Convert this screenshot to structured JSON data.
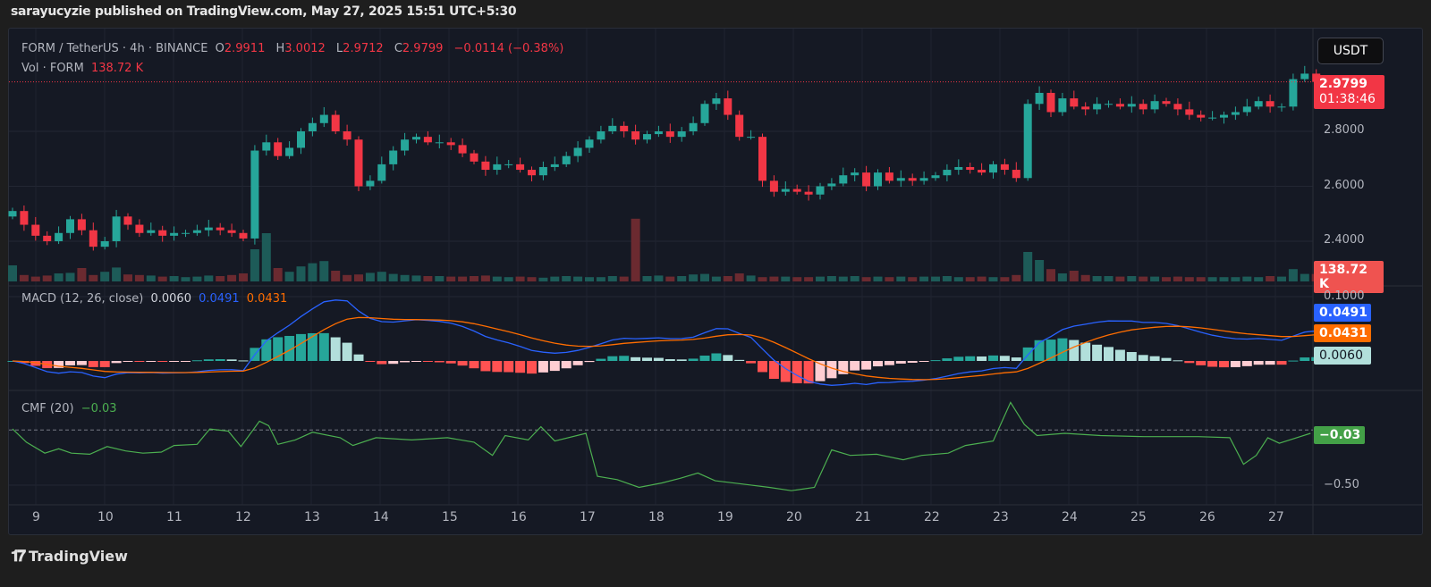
{
  "header": {
    "published": "sarayucyzie published on TradingView.com, May 27, 2025 15:51 UTC+5:30"
  },
  "legend": {
    "symbol": "FORM / TetherUS · 4h · BINANCE",
    "o_label": "O",
    "o": "2.9911",
    "h_label": "H",
    "h": "3.0012",
    "l_label": "L",
    "l": "2.9712",
    "c_label": "C",
    "c": "2.9799",
    "change": "−0.0114 (−0.38%)",
    "vol_label": "Vol · FORM",
    "vol": "138.72 K"
  },
  "currency_button": "USDT",
  "price_badge": {
    "price": "2.9799",
    "countdown": "01:38:46"
  },
  "volume_badge": "138.72 K",
  "macd": {
    "label": "MACD (12, 26, close)",
    "hist": "0.0060",
    "macd": "0.0491",
    "signal": "0.0431",
    "axis_tick": "0.1000"
  },
  "cmf": {
    "label": "CMF (20)",
    "value": "−0.03",
    "axis_tick": "−0.50"
  },
  "footer": {
    "brand": "TradingView"
  },
  "colors": {
    "up": "#26a69a",
    "down": "#f23645",
    "macd": "#2962ff",
    "signal": "#ff6d00",
    "cmf": "#4caf50"
  },
  "chart_data": {
    "type": "candlestick",
    "interval": "4h",
    "price_ticks": [
      "2.8000",
      "2.6000",
      "2.4000"
    ],
    "price_tick_values": [
      2.8,
      2.6,
      2.4
    ],
    "ylim": [
      2.32,
      3.05
    ],
    "x_tick_labels": [
      "9",
      "10",
      "11",
      "12",
      "13",
      "14",
      "15",
      "16",
      "17",
      "18",
      "19",
      "20",
      "21",
      "22",
      "23",
      "24",
      "25",
      "26",
      "27"
    ],
    "first_open": 2.49,
    "closes": [
      2.51,
      2.46,
      2.42,
      2.4,
      2.43,
      2.48,
      2.44,
      2.38,
      2.4,
      2.49,
      2.46,
      2.43,
      2.44,
      2.42,
      2.43,
      2.43,
      2.44,
      2.45,
      2.44,
      2.43,
      2.41,
      2.73,
      2.76,
      2.71,
      2.74,
      2.8,
      2.83,
      2.86,
      2.8,
      2.77,
      2.6,
      2.62,
      2.68,
      2.73,
      2.77,
      2.78,
      2.76,
      2.76,
      2.75,
      2.72,
      2.69,
      2.66,
      2.68,
      2.68,
      2.66,
      2.64,
      2.67,
      2.68,
      2.71,
      2.74,
      2.77,
      2.8,
      2.82,
      2.8,
      2.77,
      2.79,
      2.8,
      2.78,
      2.8,
      2.83,
      2.9,
      2.92,
      2.86,
      2.78,
      2.78,
      2.62,
      2.58,
      2.59,
      2.58,
      2.57,
      2.6,
      2.61,
      2.64,
      2.65,
      2.6,
      2.65,
      2.62,
      2.63,
      2.62,
      2.63,
      2.64,
      2.66,
      2.67,
      2.66,
      2.65,
      2.68,
      2.66,
      2.63,
      2.9,
      2.94,
      2.87,
      2.92,
      2.89,
      2.88,
      2.9,
      2.9,
      2.89,
      2.9,
      2.88,
      2.91,
      2.9,
      2.88,
      2.86,
      2.85,
      2.85,
      2.86,
      2.87,
      2.89,
      2.91,
      2.89,
      2.89,
      2.99,
      3.01,
      2.98
    ],
    "volumes_k": [
      300,
      120,
      90,
      110,
      150,
      160,
      250,
      120,
      180,
      260,
      130,
      120,
      110,
      90,
      100,
      80,
      90,
      110,
      100,
      120,
      150,
      600,
      900,
      250,
      180,
      280,
      340,
      380,
      200,
      120,
      130,
      160,
      180,
      140,
      120,
      110,
      100,
      100,
      90,
      90,
      100,
      110,
      90,
      80,
      90,
      80,
      70,
      90,
      100,
      90,
      80,
      80,
      100,
      90,
      1170,
      100,
      110,
      90,
      100,
      130,
      140,
      90,
      100,
      150,
      110,
      80,
      90,
      90,
      80,
      80,
      90,
      100,
      90,
      100,
      80,
      90,
      80,
      90,
      80,
      90,
      90,
      100,
      80,
      80,
      90,
      80,
      80,
      120,
      550,
      400,
      230,
      150,
      200,
      120,
      100,
      100,
      90,
      100,
      90,
      90,
      80,
      90,
      80,
      80,
      80,
      80,
      80,
      90,
      80,
      100,
      90,
      230,
      140,
      138.72
    ],
    "cmf_points": [
      [
        0,
        0.01
      ],
      [
        1.2,
        -0.11
      ],
      [
        2.8,
        -0.21
      ],
      [
        4,
        -0.17
      ],
      [
        5.1,
        -0.21
      ],
      [
        6.7,
        -0.22
      ],
      [
        8.2,
        -0.15
      ],
      [
        9.8,
        -0.19
      ],
      [
        11.3,
        -0.21
      ],
      [
        12.9,
        -0.2
      ],
      [
        14,
        -0.14
      ],
      [
        16,
        -0.13
      ],
      [
        17.1,
        0.01
      ],
      [
        18.7,
        -0.01
      ],
      [
        19.8,
        -0.15
      ],
      [
        21.4,
        0.08
      ],
      [
        22.2,
        0.04
      ],
      [
        23,
        -0.13
      ],
      [
        24.5,
        -0.09
      ],
      [
        26,
        -0.02
      ],
      [
        28.4,
        -0.07
      ],
      [
        29.5,
        -0.14
      ],
      [
        31.5,
        -0.07
      ],
      [
        34.6,
        -0.09
      ],
      [
        37.7,
        -0.07
      ],
      [
        40,
        -0.11
      ],
      [
        41.6,
        -0.23
      ],
      [
        42.7,
        -0.05
      ],
      [
        44.7,
        -0.09
      ],
      [
        45.8,
        0.03
      ],
      [
        47,
        -0.1
      ],
      [
        49.7,
        -0.03
      ],
      [
        50.7,
        -0.42
      ],
      [
        52.4,
        -0.45
      ],
      [
        54.3,
        -0.52
      ],
      [
        56.3,
        -0.48
      ],
      [
        57.8,
        -0.44
      ],
      [
        59.4,
        -0.39
      ],
      [
        60.9,
        -0.46
      ],
      [
        63.3,
        -0.49
      ],
      [
        65.6,
        -0.52
      ],
      [
        67.5,
        -0.55
      ],
      [
        69.5,
        -0.52
      ],
      [
        71,
        -0.18
      ],
      [
        72.6,
        -0.23
      ],
      [
        74.9,
        -0.22
      ],
      [
        77.2,
        -0.27
      ],
      [
        78.8,
        -0.23
      ],
      [
        81.1,
        -0.21
      ],
      [
        82.6,
        -0.14
      ],
      [
        85,
        -0.1
      ],
      [
        86.5,
        0.25
      ],
      [
        87.7,
        0.05
      ],
      [
        88.8,
        -0.05
      ],
      [
        91.2,
        -0.03
      ],
      [
        94.3,
        -0.05
      ],
      [
        98.1,
        -0.06
      ],
      [
        102.8,
        -0.06
      ],
      [
        105.5,
        -0.07
      ],
      [
        106.7,
        -0.31
      ],
      [
        107.8,
        -0.23
      ],
      [
        108.8,
        -0.07
      ],
      [
        109.8,
        -0.12
      ],
      [
        111.3,
        -0.07
      ],
      [
        112.5,
        -0.03
      ]
    ],
    "cmf_ylim": [
      -0.8,
      0.35
    ]
  }
}
